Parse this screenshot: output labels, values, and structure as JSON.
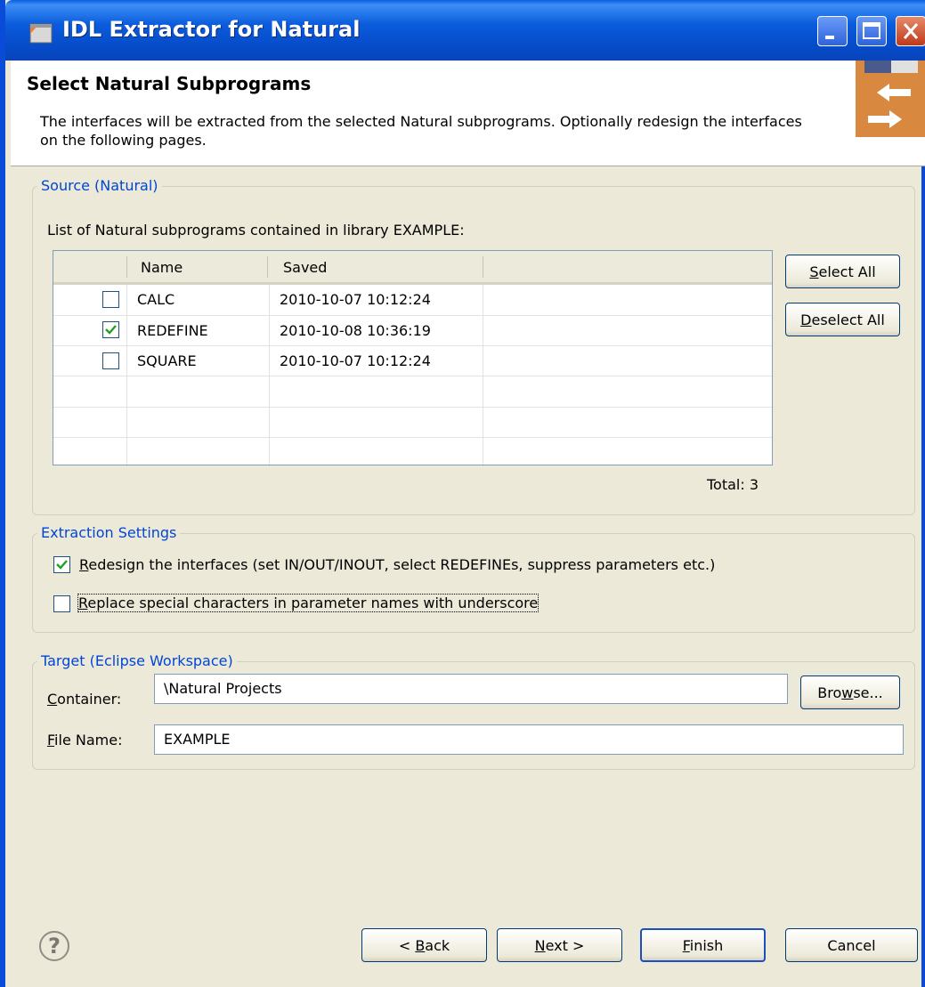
{
  "window": {
    "title": "IDL Extractor for Natural"
  },
  "header": {
    "title": "Select Natural Subprograms",
    "description": "The interfaces will be extracted from the selected Natural subprograms. Optionally redesign the interfaces on the following pages."
  },
  "source": {
    "legend": "Source (Natural)",
    "list_label": "List of Natural subprograms contained in library EXAMPLE:",
    "columns": [
      "Name",
      "Saved"
    ],
    "rows": [
      {
        "name": "CALC",
        "saved": "2010-10-07 10:12:24",
        "checked": false
      },
      {
        "name": "REDEFINE",
        "saved": "2010-10-08 10:36:19",
        "checked": true
      },
      {
        "name": "SQUARE",
        "saved": "2010-10-07 10:12:24",
        "checked": false
      }
    ],
    "select_all": {
      "mnemonic": "S",
      "rest": "elect All"
    },
    "deselect_all": {
      "mnemonic": "D",
      "rest": "eselect All"
    },
    "total": "Total: 3"
  },
  "extraction": {
    "legend": "Extraction Settings",
    "redesign": {
      "mnemonic": "R",
      "rest": "edesign the interfaces (set IN/OUT/INOUT, select REDEFINEs, suppress parameters etc.)",
      "checked": true
    },
    "replace": {
      "mnemonic": "R",
      "rest": "eplace special characters in parameter names with underscore",
      "checked": false
    }
  },
  "target": {
    "legend": "Target (Eclipse Workspace)",
    "container_label": {
      "mnemonic": "C",
      "rest": "ontainer:"
    },
    "container_value": "\\Natural Projects",
    "browse": {
      "pre": "Bro",
      "mnemonic": "w",
      "rest": "se..."
    },
    "filename_label": {
      "mnemonic": "F",
      "rest": "ile Name:"
    },
    "filename_value": "EXAMPLE"
  },
  "buttons": {
    "back": {
      "pre": "< ",
      "mnemonic": "B",
      "rest": "ack"
    },
    "next": {
      "mnemonic": "N",
      "rest": "ext >"
    },
    "finish": {
      "mnemonic": "F",
      "rest": "inish"
    },
    "cancel": "Cancel"
  }
}
